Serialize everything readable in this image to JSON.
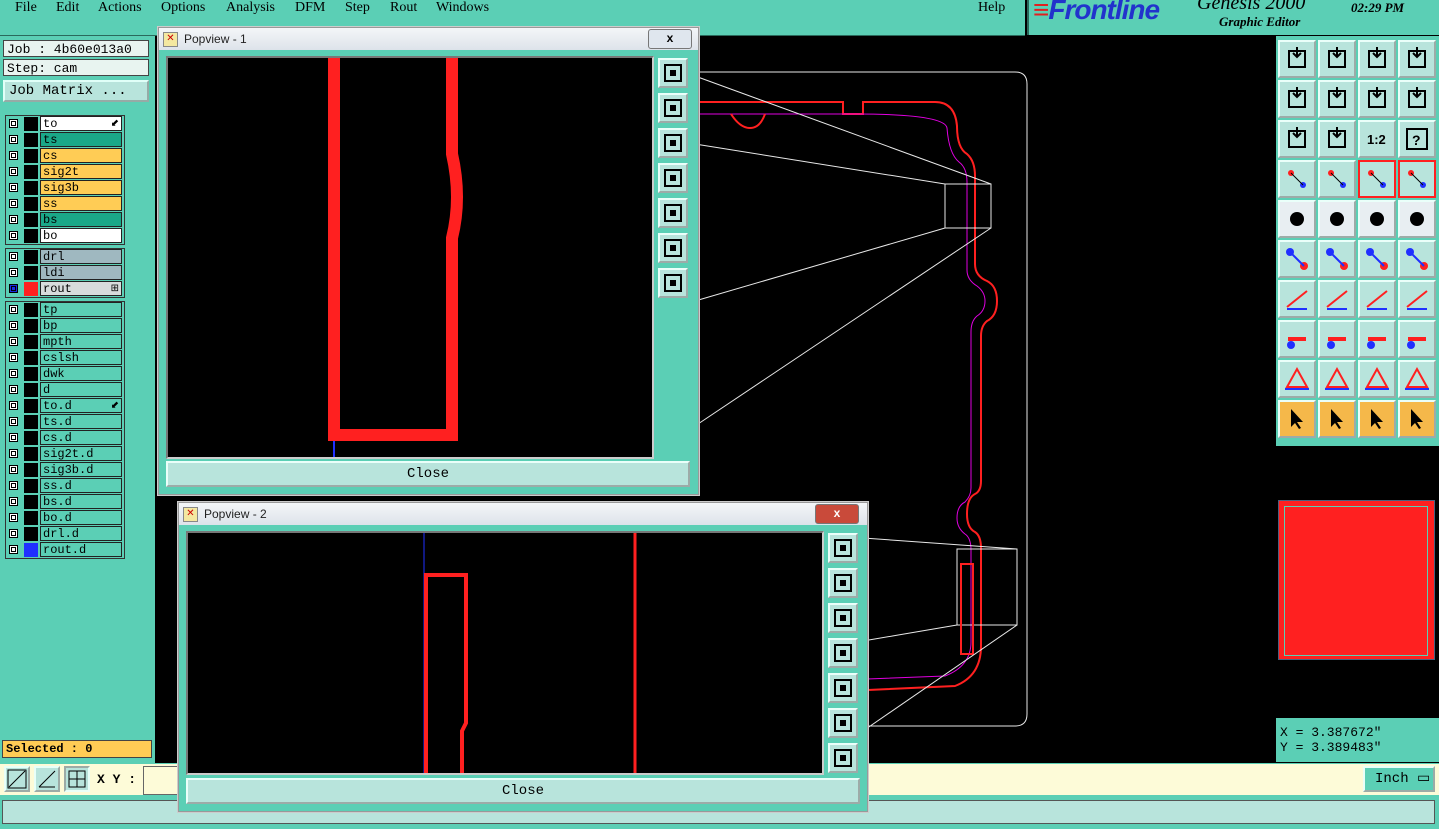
{
  "menubar": {
    "items": [
      "File",
      "Edit",
      "Actions",
      "Options",
      "Analysis",
      "DFM",
      "Step",
      "Rout",
      "Windows"
    ],
    "help": "Help"
  },
  "brand": {
    "logo": "Frontline",
    "product": "Genesis 2000",
    "subtitle": "Graphic Editor",
    "clock": "02:29 PM"
  },
  "job": {
    "job_line": "Job : 4b60e013a0",
    "step_line": "Step: cam",
    "matrix_button": "Job Matrix ..."
  },
  "layers": {
    "group1": [
      {
        "name": "to",
        "color": "#ffffff",
        "mark": "⬋"
      },
      {
        "name": "ts",
        "color": "#1aa888"
      },
      {
        "name": "cs",
        "color": "#ffcc55"
      },
      {
        "name": "sig2t",
        "color": "#ffcc55"
      },
      {
        "name": "sig3b",
        "color": "#ffcc55"
      },
      {
        "name": "ss",
        "color": "#ffcc55"
      },
      {
        "name": "bs",
        "color": "#1aa888"
      },
      {
        "name": "bo",
        "color": "#ffffff"
      }
    ],
    "group2": [
      {
        "name": "drl",
        "color": "#9fb8c0"
      },
      {
        "name": "ldi",
        "color": "#9fb8c0"
      },
      {
        "name": "rout",
        "color": "#d8dcdc",
        "swatch": "#ff2020",
        "mark": "⊞",
        "active": true
      }
    ],
    "group3": [
      {
        "name": "tp",
        "color": "#5bcfb5"
      },
      {
        "name": "bp",
        "color": "#5bcfb5"
      },
      {
        "name": "mpth",
        "color": "#5bcfb5"
      },
      {
        "name": "cslsh",
        "color": "#5bcfb5"
      },
      {
        "name": "dwk",
        "color": "#5bcfb5"
      },
      {
        "name": "d",
        "color": "#5bcfb5"
      },
      {
        "name": "to.d",
        "color": "#5bcfb5",
        "mark": "⬋"
      },
      {
        "name": "ts.d",
        "color": "#5bcfb5"
      },
      {
        "name": "cs.d",
        "color": "#5bcfb5"
      },
      {
        "name": "sig2t.d",
        "color": "#5bcfb5"
      },
      {
        "name": "sig3b.d",
        "color": "#5bcfb5"
      },
      {
        "name": "ss.d",
        "color": "#5bcfb5"
      },
      {
        "name": "bs.d",
        "color": "#5bcfb5"
      },
      {
        "name": "bo.d",
        "color": "#5bcfb5"
      },
      {
        "name": "drl.d",
        "color": "#5bcfb5"
      },
      {
        "name": "rout.d",
        "color": "#5bcfb5",
        "swatch": "#2030ff"
      }
    ]
  },
  "selected": "Selected : 0",
  "popview1": {
    "title": "Popview - 1",
    "close": "Close",
    "x": "x"
  },
  "popview2": {
    "title": "Popview - 2",
    "close": "Close",
    "x": "x"
  },
  "xy": {
    "label": "X Y :",
    "value": ""
  },
  "units": "Inch",
  "coords": {
    "x": "X = 3.387672\"",
    "y": "Y = 3.389483\""
  },
  "toolbar_ratio_label": "1:2",
  "toolbar_help_label": "?"
}
